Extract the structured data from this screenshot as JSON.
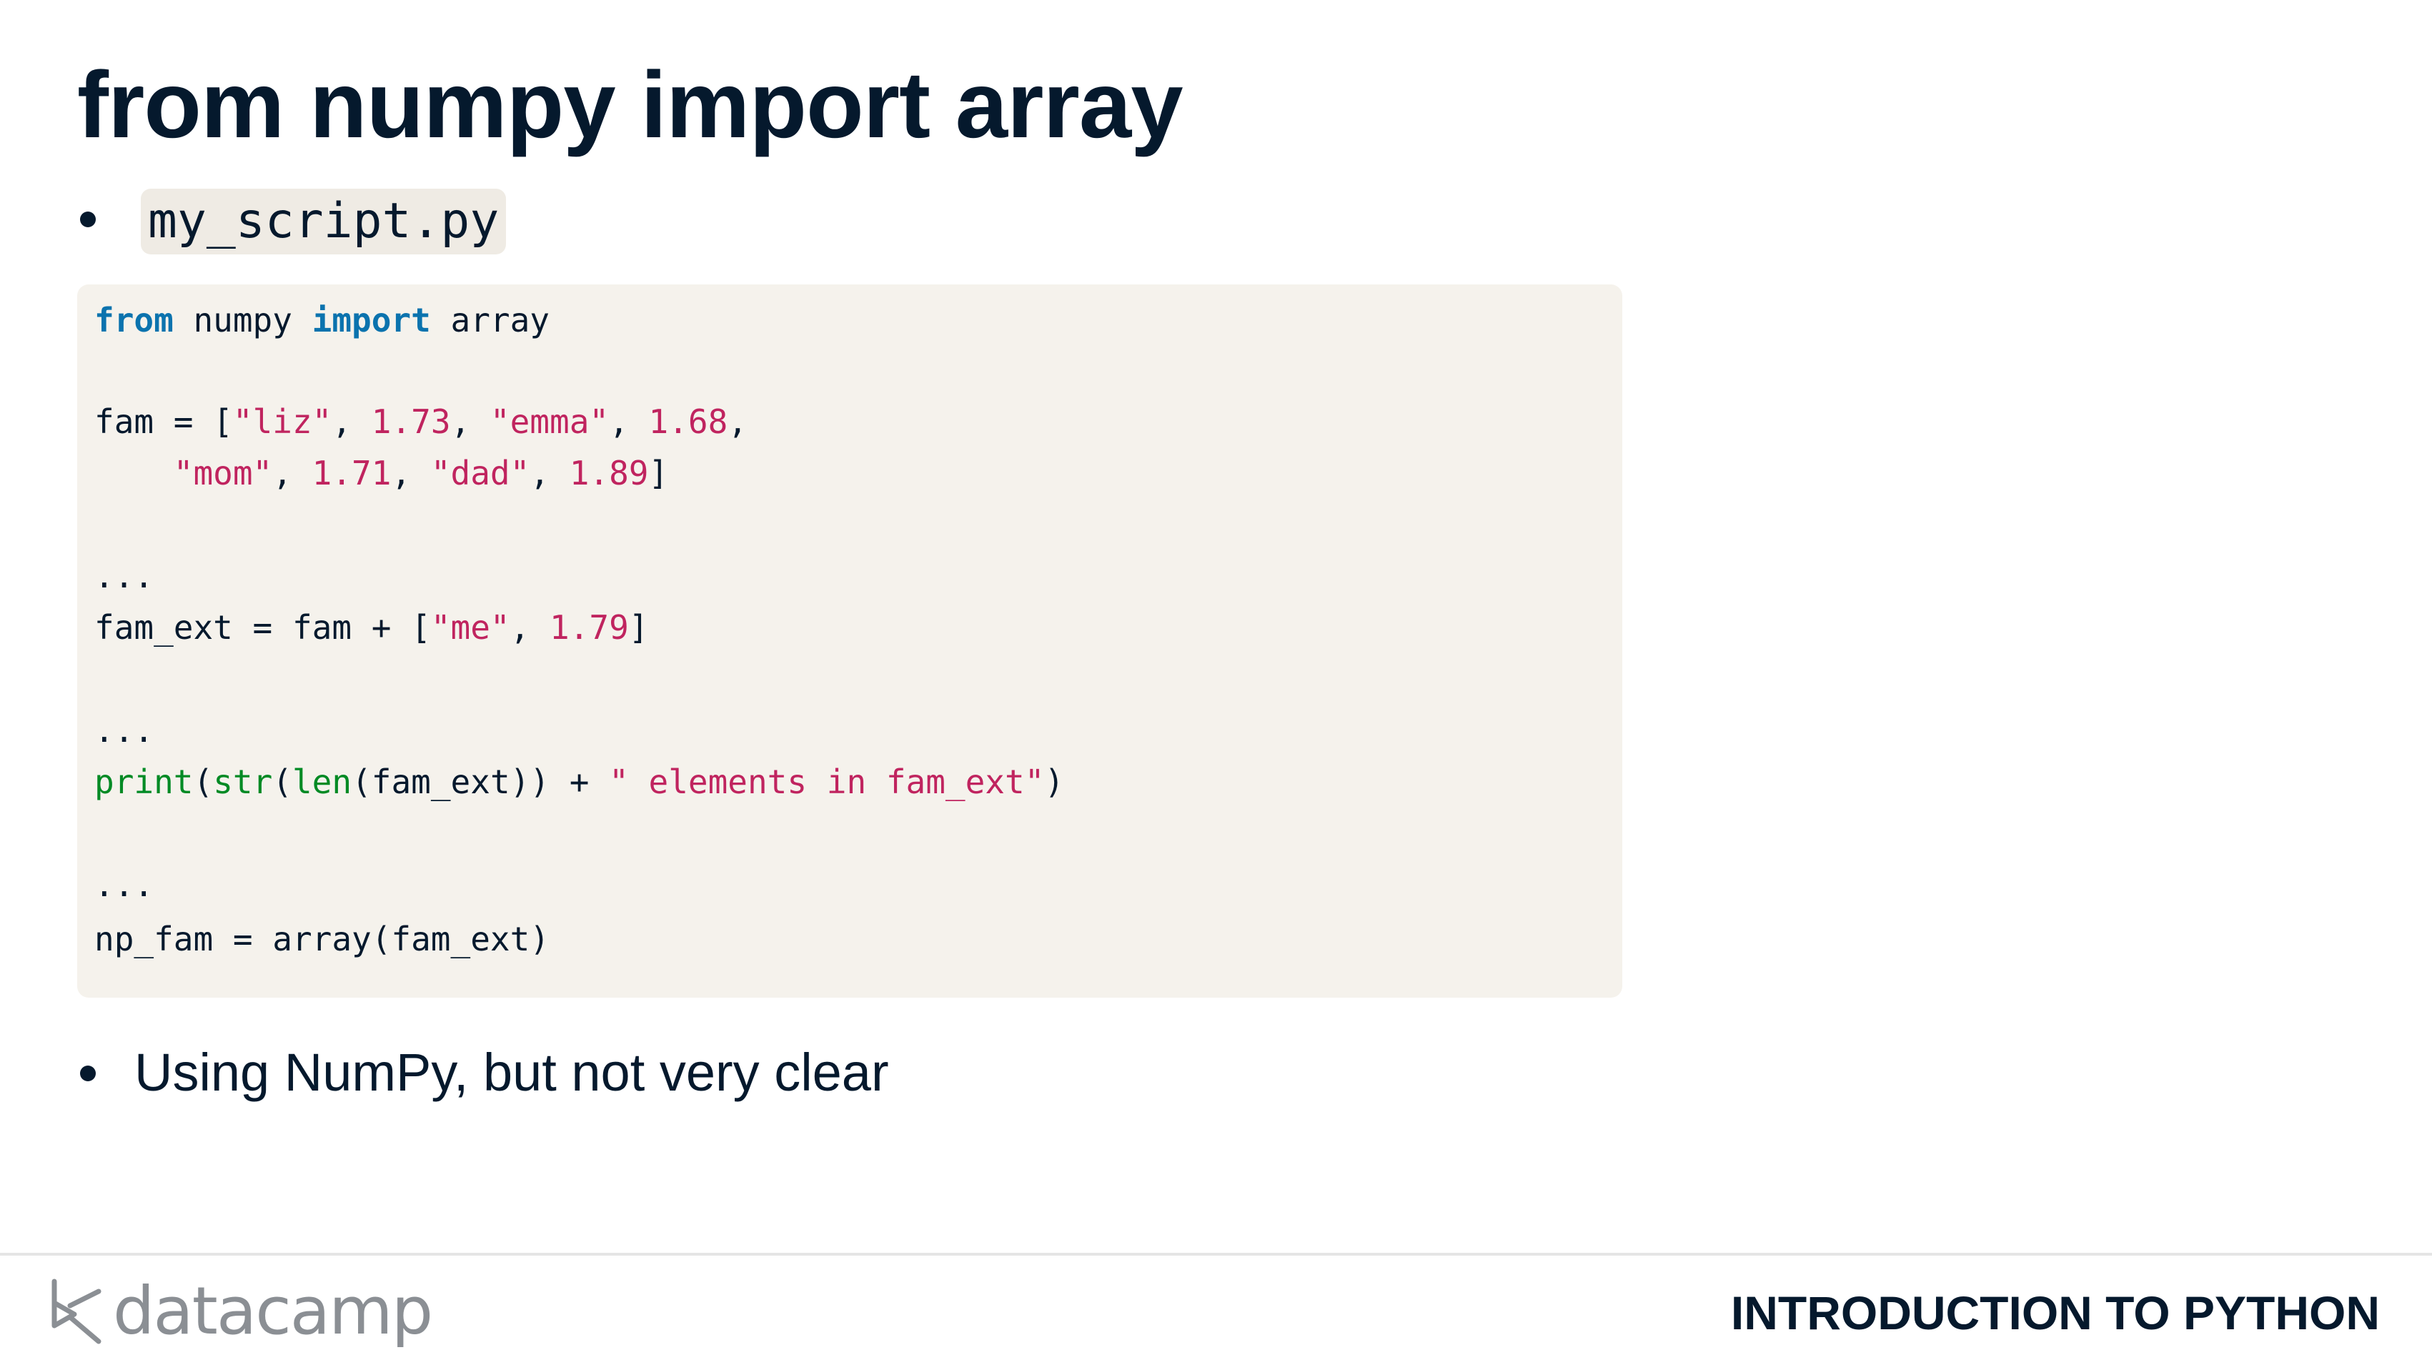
{
  "slide": {
    "title": "from numpy import array"
  },
  "bullets": [
    {
      "filename": "my_script.py"
    },
    {
      "text": "Using NumPy, but not very clear"
    }
  ],
  "code": {
    "line1": {
      "kw1": "from",
      "t1": " numpy ",
      "kw2": "import",
      "t2": " array"
    },
    "line2": {
      "t1": "fam = [",
      "s1": "\"liz\"",
      "t2": ", ",
      "n1": "1.73",
      "t3": ", ",
      "s2": "\"emma\"",
      "t4": ", ",
      "n2": "1.68",
      "t5": ","
    },
    "line3": {
      "t0": "    ",
      "s1": "\"mom\"",
      "t1": ", ",
      "n1": "1.71",
      "t2": ", ",
      "s2": "\"dad\"",
      "t3": ", ",
      "n2": "1.89",
      "t4": "]"
    },
    "line4": {
      "t1": "..."
    },
    "line5": {
      "t1": "fam_ext = fam + [",
      "s1": "\"me\"",
      "t2": ", ",
      "n1": "1.79",
      "t3": "]"
    },
    "line6": {
      "t1": "..."
    },
    "line7": {
      "f1": "print",
      "t1": "(",
      "f2": "str",
      "t2": "(",
      "f3": "len",
      "t3": "(fam_ext)) + ",
      "s1": "\" elements in fam_ext\"",
      "t4": ")"
    },
    "line8": {
      "t1": "..."
    },
    "line9": {
      "t1": "np_fam = array(fam_ext)"
    }
  },
  "footer": {
    "logo_text": "datacamp",
    "course_name": "INTRODUCTION TO PYTHON"
  },
  "colors": {
    "text": "#05192d",
    "keyword": "#0b73ae",
    "string": "#c0245f",
    "builtin": "#008a24",
    "code_bg": "#f5f2ec",
    "logo": "#8b8f94"
  }
}
